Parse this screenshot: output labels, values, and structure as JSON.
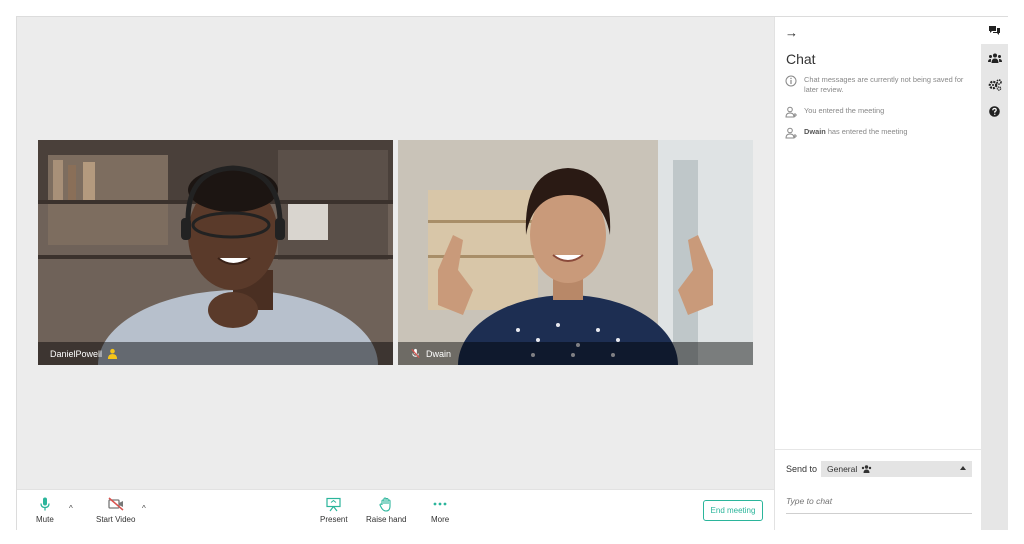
{
  "participants": [
    {
      "name": "DanielPowell",
      "role": "moderator"
    },
    {
      "name": "Dwain",
      "role": "muted"
    }
  ],
  "toolbar": {
    "mute_label": "Mute",
    "start_video_label": "Start Video",
    "present_label": "Present",
    "raise_hand_label": "Raise hand",
    "more_label": "More",
    "end_meeting_label": "End meeting"
  },
  "chat": {
    "back_icon": "arrow-right-icon",
    "title": "Chat",
    "messages": [
      {
        "icon": "info-icon",
        "bold": "",
        "text": "Chat messages are currently not being saved for later review."
      },
      {
        "icon": "user-plus-icon",
        "bold": "",
        "text": "You entered the meeting"
      },
      {
        "icon": "user-plus-icon",
        "bold": "Dwain",
        "text": " has entered the meeting"
      }
    ],
    "send_to_label": "Send to",
    "send_to_value": "General",
    "input_placeholder": "Type to chat"
  },
  "rail": {
    "items": [
      "chat-icon",
      "users-icon",
      "settings-icon",
      "help-icon"
    ]
  },
  "colors": {
    "accent": "#2bb59b",
    "muted_red": "#d9534f",
    "moderator_yellow": "#f5c518",
    "stage_bg": "#ececec"
  }
}
